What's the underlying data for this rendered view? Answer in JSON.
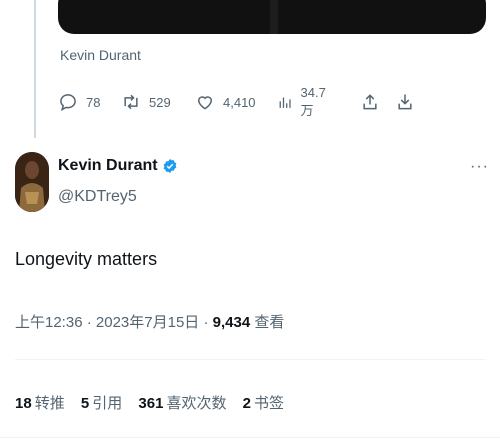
{
  "quoted": {
    "caption": "Kevin Durant",
    "actions": {
      "reply_count": "78",
      "retweet_count": "529",
      "like_count": "4,410",
      "view_count": "34.7万"
    }
  },
  "author": {
    "name": "Kevin Durant",
    "handle": "@KDTrey5",
    "more_label": "···"
  },
  "tweet": {
    "text": "Longevity matters",
    "time": "上午12:36",
    "sep1": "·",
    "date": "2023年7月15日",
    "sep2": "·",
    "views": "9,434",
    "views_label": "查看"
  },
  "stats": {
    "retweets_n": "18",
    "retweets_l": "转推",
    "quotes_n": "5",
    "quotes_l": "引用",
    "likes_n": "361",
    "likes_l": "喜欢次数",
    "bookmarks_n": "2",
    "bookmarks_l": "书签"
  },
  "colors": {
    "text_primary": "#0f1419",
    "text_secondary": "#536471",
    "verified": "#1d9bf0",
    "divider": "#eff3f4"
  }
}
